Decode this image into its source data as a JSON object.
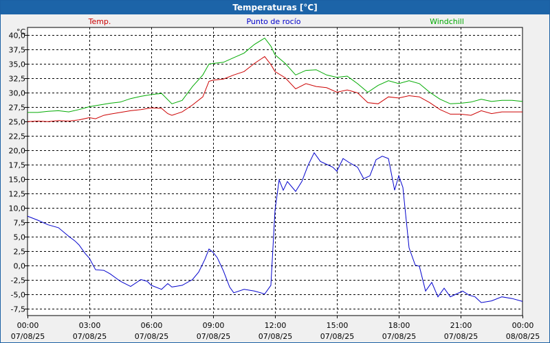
{
  "window": {
    "title": "Temperaturas [°C]"
  },
  "chart_data": {
    "type": "line",
    "title": "Temperaturas [°C]",
    "ylabel": "°C",
    "ylim": [
      -8.75,
      41.25
    ],
    "grid": true,
    "legend_placement": "top",
    "y_ticks": [
      "40,0",
      "37,5",
      "35,0",
      "32,5",
      "30,0",
      "27,5",
      "25,0",
      "22,5",
      "20,0",
      "17,5",
      "15,0",
      "12,5",
      "10,0",
      "7,5",
      "5,0",
      "2,5",
      "0,0",
      "-2,5",
      "-5,0",
      "-7,5"
    ],
    "y_tick_values": [
      40,
      37.5,
      35,
      32.5,
      30,
      27.5,
      25,
      22.5,
      20,
      17.5,
      15,
      12.5,
      10,
      7.5,
      5,
      2.5,
      0,
      -2.5,
      -5,
      -7.5
    ],
    "x_ticks": [
      {
        "time": "00:00",
        "date": "07/08/25",
        "h": 0
      },
      {
        "time": "03:00",
        "date": "07/08/25",
        "h": 3
      },
      {
        "time": "06:00",
        "date": "07/08/25",
        "h": 6
      },
      {
        "time": "09:00",
        "date": "07/08/25",
        "h": 9
      },
      {
        "time": "12:00",
        "date": "07/08/25",
        "h": 12
      },
      {
        "time": "15:00",
        "date": "07/08/25",
        "h": 15
      },
      {
        "time": "18:00",
        "date": "07/08/25",
        "h": 18
      },
      {
        "time": "21:00",
        "date": "07/08/25",
        "h": 21
      },
      {
        "time": "00:00",
        "date": "08/08/25",
        "h": 24
      }
    ],
    "series": [
      {
        "name": "Temp.",
        "color": "#cc0000",
        "points": [
          [
            0,
            24.9
          ],
          [
            0.5,
            25.0
          ],
          [
            1,
            24.9
          ],
          [
            1.5,
            25.1
          ],
          [
            2,
            25.0
          ],
          [
            2.5,
            25.2
          ],
          [
            3,
            25.6
          ],
          [
            3.3,
            25.4
          ],
          [
            3.7,
            26.0
          ],
          [
            4,
            26.2
          ],
          [
            4.5,
            26.5
          ],
          [
            5,
            26.8
          ],
          [
            5.5,
            27.0
          ],
          [
            6,
            27.3
          ],
          [
            6.5,
            27.2
          ],
          [
            6.8,
            26.3
          ],
          [
            7,
            26.0
          ],
          [
            7.5,
            26.6
          ],
          [
            8,
            27.8
          ],
          [
            8.5,
            29.2
          ],
          [
            8.8,
            31.9
          ],
          [
            9,
            32.1
          ],
          [
            9.5,
            32.3
          ],
          [
            10,
            33.0
          ],
          [
            10.5,
            33.6
          ],
          [
            11,
            35.0
          ],
          [
            11.5,
            36.2
          ],
          [
            11.8,
            34.8
          ],
          [
            12,
            33.6
          ],
          [
            12.5,
            32.5
          ],
          [
            13,
            30.6
          ],
          [
            13.5,
            31.5
          ],
          [
            14,
            31.0
          ],
          [
            14.5,
            30.8
          ],
          [
            15,
            30.0
          ],
          [
            15.5,
            30.4
          ],
          [
            16,
            29.9
          ],
          [
            16.5,
            28.2
          ],
          [
            17,
            28.0
          ],
          [
            17.5,
            29.2
          ],
          [
            18,
            29.0
          ],
          [
            18.5,
            29.4
          ],
          [
            19,
            29.2
          ],
          [
            19.5,
            28.2
          ],
          [
            20,
            27.0
          ],
          [
            20.5,
            26.2
          ],
          [
            21,
            26.2
          ],
          [
            21.5,
            26.0
          ],
          [
            22,
            26.8
          ],
          [
            22.5,
            26.3
          ],
          [
            23,
            26.6
          ],
          [
            23.5,
            26.6
          ],
          [
            24,
            26.6
          ]
        ]
      },
      {
        "name": "Punto de rocío",
        "color": "#0000cc",
        "points": [
          [
            0,
            8.5
          ],
          [
            0.5,
            7.8
          ],
          [
            1,
            7.0
          ],
          [
            1.5,
            6.5
          ],
          [
            2,
            5.0
          ],
          [
            2.3,
            4.2
          ],
          [
            2.5,
            3.5
          ],
          [
            2.8,
            2.0
          ],
          [
            3,
            1.2
          ],
          [
            3.3,
            -0.8
          ],
          [
            3.7,
            -0.9
          ],
          [
            4,
            -1.5
          ],
          [
            4.5,
            -2.8
          ],
          [
            5,
            -3.7
          ],
          [
            5.5,
            -2.5
          ],
          [
            5.8,
            -2.8
          ],
          [
            6,
            -3.5
          ],
          [
            6.5,
            -4.2
          ],
          [
            6.8,
            -3.2
          ],
          [
            7,
            -3.8
          ],
          [
            7.5,
            -3.5
          ],
          [
            8,
            -2.5
          ],
          [
            8.3,
            -1.2
          ],
          [
            8.6,
            1.0
          ],
          [
            8.8,
            2.8
          ],
          [
            9,
            2.2
          ],
          [
            9.2,
            1.3
          ],
          [
            9.5,
            -1.0
          ],
          [
            9.8,
            -3.8
          ],
          [
            10,
            -4.8
          ],
          [
            10.5,
            -4.2
          ],
          [
            11,
            -4.5
          ],
          [
            11.5,
            -5.0
          ],
          [
            11.8,
            -3.5
          ],
          [
            12,
            9.5
          ],
          [
            12.2,
            14.8
          ],
          [
            12.4,
            13.0
          ],
          [
            12.6,
            14.5
          ],
          [
            13,
            12.8
          ],
          [
            13.3,
            14.5
          ],
          [
            13.6,
            17.3
          ],
          [
            13.9,
            19.5
          ],
          [
            14.2,
            18.0
          ],
          [
            14.5,
            17.5
          ],
          [
            14.8,
            17.0
          ],
          [
            15,
            16.3
          ],
          [
            15.3,
            18.5
          ],
          [
            15.6,
            17.8
          ],
          [
            16,
            17.0
          ],
          [
            16.3,
            15.0
          ],
          [
            16.6,
            15.5
          ],
          [
            16.9,
            18.3
          ],
          [
            17.2,
            18.9
          ],
          [
            17.5,
            18.5
          ],
          [
            17.8,
            13.0
          ],
          [
            18,
            15.5
          ],
          [
            18.2,
            13.5
          ],
          [
            18.5,
            3.0
          ],
          [
            18.8,
            0.0
          ],
          [
            19,
            -0.2
          ],
          [
            19.3,
            -4.5
          ],
          [
            19.6,
            -3.0
          ],
          [
            19.9,
            -5.5
          ],
          [
            20.2,
            -4.0
          ],
          [
            20.5,
            -5.5
          ],
          [
            20.8,
            -5.0
          ],
          [
            21.1,
            -4.5
          ],
          [
            21.4,
            -5.2
          ],
          [
            21.7,
            -5.5
          ],
          [
            22,
            -6.5
          ],
          [
            22.5,
            -6.2
          ],
          [
            23,
            -5.5
          ],
          [
            23.5,
            -5.8
          ],
          [
            24,
            -6.3
          ]
        ]
      },
      {
        "name": "Windchill",
        "color": "#00aa00",
        "points": [
          [
            0,
            26.5
          ],
          [
            0.5,
            26.5
          ],
          [
            1,
            26.7
          ],
          [
            1.5,
            26.8
          ],
          [
            2,
            26.6
          ],
          [
            2.5,
            27.0
          ],
          [
            3,
            27.5
          ],
          [
            3.5,
            27.8
          ],
          [
            4,
            28.1
          ],
          [
            4.5,
            28.3
          ],
          [
            5,
            28.9
          ],
          [
            5.5,
            29.3
          ],
          [
            6,
            29.6
          ],
          [
            6.5,
            29.8
          ],
          [
            7,
            28.0
          ],
          [
            7.5,
            28.6
          ],
          [
            8,
            31.0
          ],
          [
            8.5,
            33.0
          ],
          [
            8.8,
            34.9
          ],
          [
            9,
            35.0
          ],
          [
            9.5,
            35.2
          ],
          [
            10,
            36.0
          ],
          [
            10.5,
            36.8
          ],
          [
            11,
            38.3
          ],
          [
            11.5,
            39.4
          ],
          [
            11.8,
            38.0
          ],
          [
            12,
            36.5
          ],
          [
            12.5,
            35.0
          ],
          [
            13,
            33.0
          ],
          [
            13.5,
            33.8
          ],
          [
            14,
            33.9
          ],
          [
            14.5,
            33.0
          ],
          [
            15,
            32.6
          ],
          [
            15.5,
            32.8
          ],
          [
            16,
            31.5
          ],
          [
            16.5,
            30.0
          ],
          [
            17,
            31.2
          ],
          [
            17.5,
            32.0
          ],
          [
            18,
            31.5
          ],
          [
            18.5,
            32.0
          ],
          [
            19,
            31.5
          ],
          [
            19.5,
            30.0
          ],
          [
            20,
            28.8
          ],
          [
            20.5,
            28.0
          ],
          [
            21,
            28.1
          ],
          [
            21.5,
            28.3
          ],
          [
            22,
            28.8
          ],
          [
            22.5,
            28.4
          ],
          [
            23,
            28.6
          ],
          [
            23.5,
            28.6
          ],
          [
            24,
            28.4
          ]
        ]
      }
    ]
  }
}
